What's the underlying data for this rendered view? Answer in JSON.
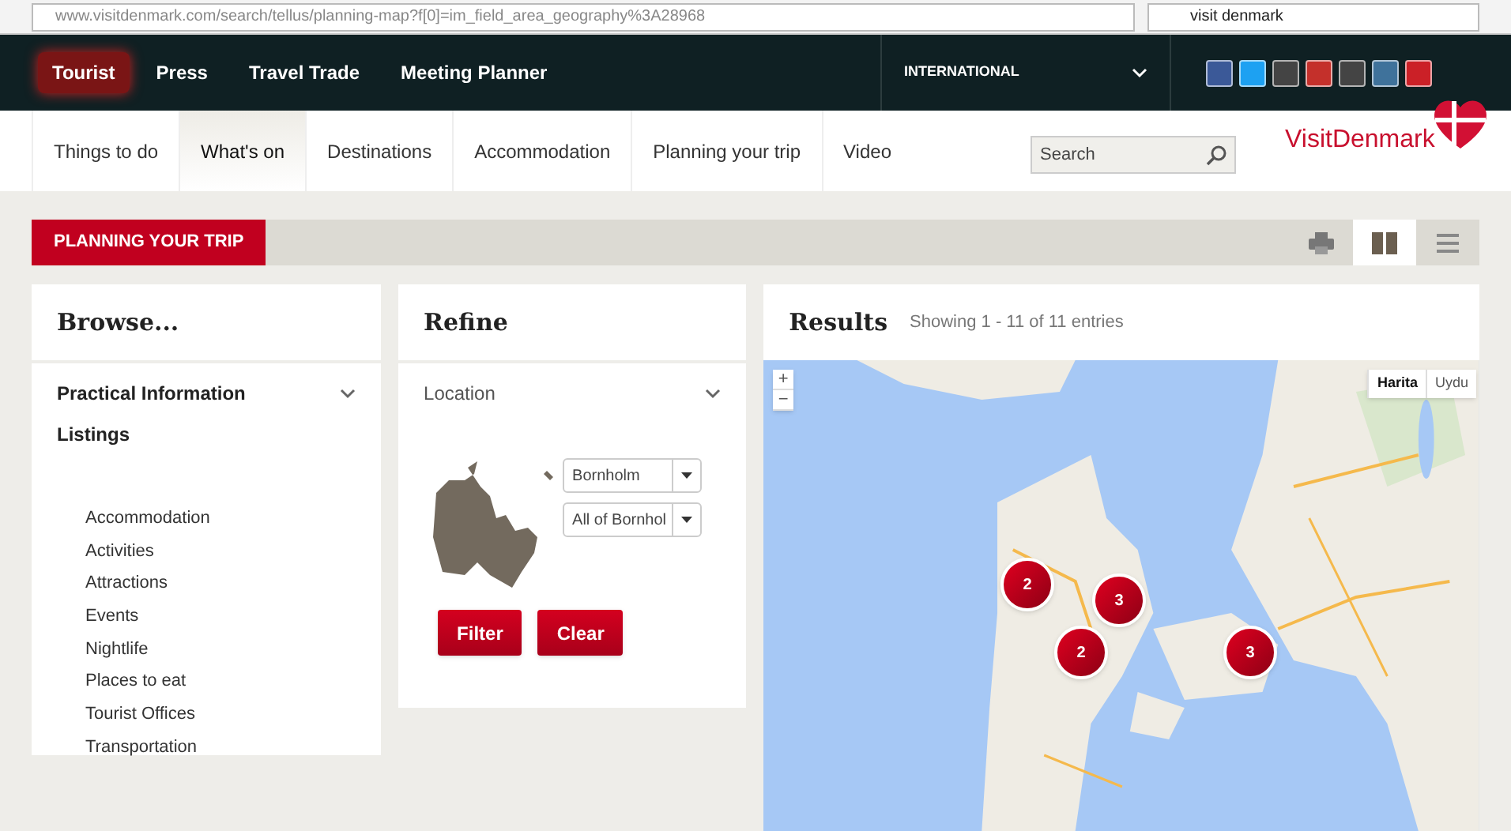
{
  "browser": {
    "url": "www.visitdenmark.com/search/tellus/planning-map?f[0]=im_field_area_geography%3A28968",
    "search": "visit denmark"
  },
  "top_nav": {
    "items": [
      {
        "label": "Tourist",
        "selected": true
      },
      {
        "label": "Press",
        "selected": false
      },
      {
        "label": "Travel Trade",
        "selected": false
      },
      {
        "label": "Meeting Planner",
        "selected": false
      }
    ],
    "region": "INTERNATIONAL"
  },
  "main_nav": {
    "items": [
      {
        "label": "Things to do",
        "selected": false
      },
      {
        "label": "What's on",
        "selected": true
      },
      {
        "label": "Destinations",
        "selected": false
      },
      {
        "label": "Accommodation",
        "selected": false
      },
      {
        "label": "Planning your trip",
        "selected": false
      },
      {
        "label": "Video",
        "selected": false
      }
    ],
    "search_placeholder": "Search",
    "logo": "VisitDenmark"
  },
  "section": {
    "title": "PLANNING YOUR TRIP",
    "views": [
      {
        "kind": "print",
        "selected": false
      },
      {
        "kind": "map",
        "selected": true
      },
      {
        "kind": "list",
        "selected": false
      }
    ]
  },
  "browse": {
    "title": "Browse...",
    "groups": [
      {
        "label": "Practical Information",
        "expanded": false
      },
      {
        "label": "Listings",
        "expanded": true
      }
    ],
    "items": [
      "Accommodation",
      "Activities",
      "Attractions",
      "Events",
      "Nightlife",
      "Places to eat",
      "Tourist Offices",
      "Transportation"
    ]
  },
  "refine": {
    "title": "Refine",
    "facet": "Location",
    "selects": [
      "Bornholm",
      "All of Bornhol"
    ],
    "buttons": [
      "Filter",
      "Clear"
    ]
  },
  "results": {
    "title": "Results",
    "summary": "Showing 1 - 11 of 11 entries",
    "map_types": [
      {
        "label": "Harita",
        "selected": true
      },
      {
        "label": "Uydu",
        "selected": false
      }
    ],
    "zoom": [
      "+",
      "−"
    ],
    "clusters": [
      "2",
      "3",
      "2",
      "3"
    ]
  }
}
